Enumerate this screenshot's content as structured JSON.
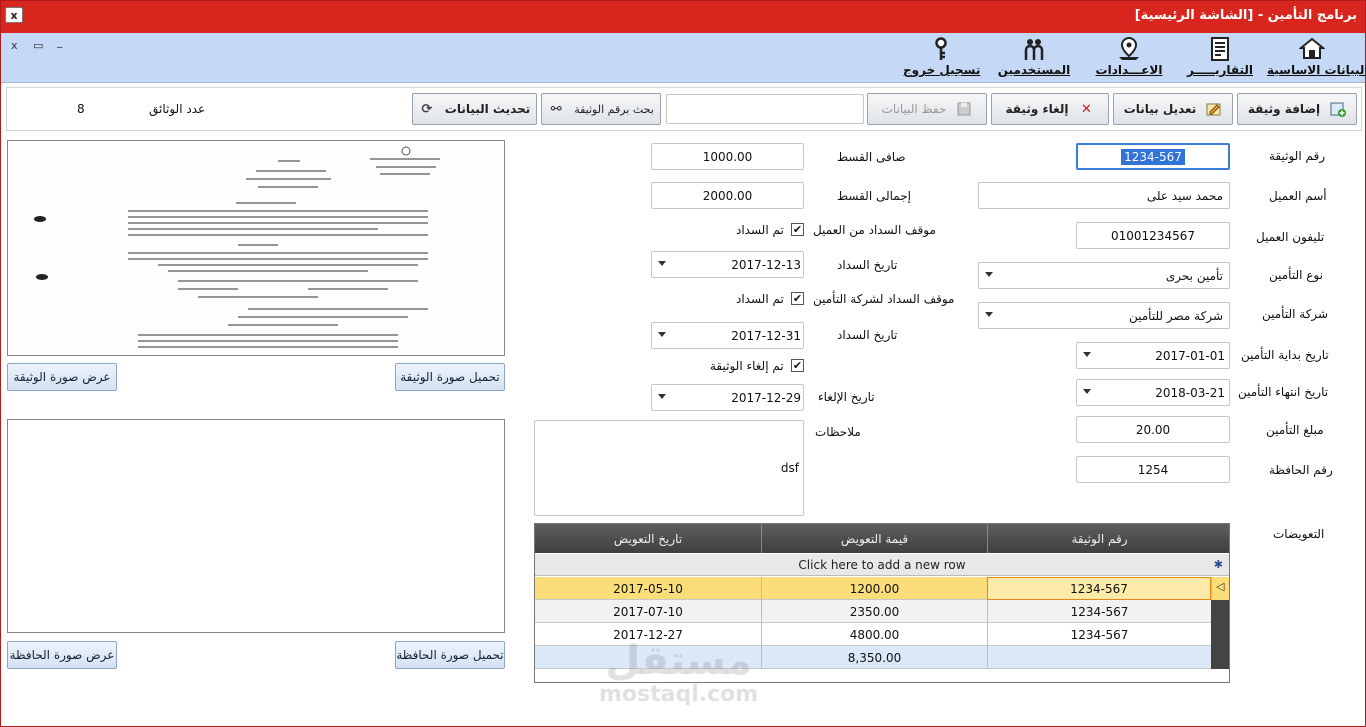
{
  "window": {
    "title": "برنامج التأمين - [الشاشة الرئيسية]",
    "close_label": "x"
  },
  "mdi_controls": {
    "close": "x",
    "restore": "▭",
    "minimize": "_"
  },
  "menu": [
    {
      "label": "البيانات الاساسية",
      "icon": "home-icon"
    },
    {
      "label": "التقاريـــــر",
      "icon": "report-icon"
    },
    {
      "label": "الاعـــدادات",
      "icon": "settings-pin-icon"
    },
    {
      "label": "المستخدمين",
      "icon": "users-icon"
    },
    {
      "label": "تسجيل خروج",
      "icon": "key-icon"
    }
  ],
  "toolbar": {
    "add": "إضافة وثيقة",
    "edit": "تعديل بيانات",
    "cancel": "إلغاء وثيقة",
    "save": "حفظ البيانات",
    "search_value": "",
    "search": "بحث برقم الوثيقة",
    "refresh": "تحديث البيانات",
    "count_label": "عدد الوثائق",
    "count_value": "8"
  },
  "form": {
    "policy_no_label": "رقم الوثيقة",
    "policy_no": "1234-567",
    "client_name_label": "أسم العميل",
    "client_name": "محمد سيد على",
    "phone_label": "تليفون العميل",
    "phone": "01001234567",
    "ins_type_label": "نوع التأمين",
    "ins_type": "تأمين بحرى",
    "company_label": "شركة التأمين",
    "company": "شركة مصر للتأمين",
    "start_label": "تاريخ بداية التأمين",
    "start": "2017-01-01",
    "end_label": "تاريخ انتهاء التأمين",
    "end": "2018-03-21",
    "amount_label": "مبلغ التأمين",
    "amount": "20.00",
    "wallet_label": "رقم الحافظة",
    "wallet": "1254",
    "net_label": "صافى القسط",
    "net": "1000.00",
    "total_label": "إجمالى القسط",
    "total": "2000.00",
    "client_pay_label": "موقف السداد من العميل",
    "paid_label": "تم السداد",
    "pay_date_label": "تاريخ السداد",
    "pay_date1": "2017-12-13",
    "company_pay_label": "موقف السداد لشركة التأمين",
    "pay_date2": "2017-12-31",
    "cancelled_label": "تم إلغاء الوثيقة",
    "cancel_date_label": "تاريخ الإلغاء",
    "cancel_date": "2017-12-29",
    "notes_label": "ملاحظات",
    "notes": "dsf",
    "comp_label": "التعويضات",
    "check": "✔"
  },
  "images": {
    "load_policy": "تحميل صورة الوثيقة",
    "show_policy": "عرض صورة الوثيقة",
    "load_wallet": "تحميل صورة الحافظة",
    "show_wallet": "عرض صورة الحافظة"
  },
  "grid": {
    "headers": [
      "رقم الوثيقة",
      "قيمة التعويض",
      "تاريخ التعويض"
    ],
    "new_row": "Click here to add a new row",
    "rows": [
      [
        "1234-567",
        "1200.00",
        "2017-05-10"
      ],
      [
        "1234-567",
        "2350.00",
        "2017-07-10"
      ],
      [
        "1234-567",
        "4800.00",
        "2017-12-27"
      ]
    ],
    "total": "8,350.00"
  },
  "watermark": {
    "ar": "مستقل",
    "en": "mostaql.com"
  }
}
